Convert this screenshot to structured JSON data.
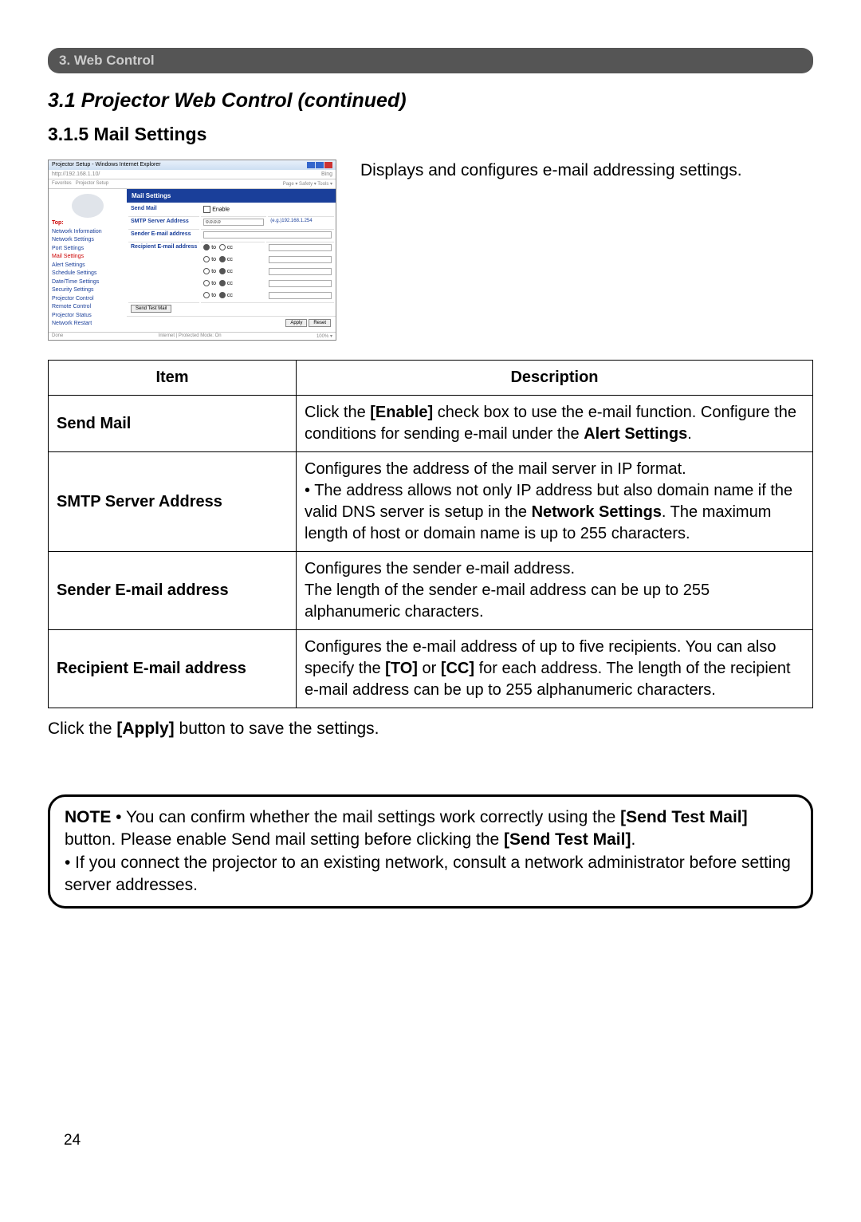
{
  "sectionHeader": "3. Web Control",
  "sectionTitle": "3.1 Projector Web Control (continued)",
  "subsectionTitle": "3.1.5 Mail Settings",
  "introText": "Displays and configures e-mail addressing settings.",
  "mini": {
    "windowTitle": "Projector Setup - Windows Internet Explorer",
    "url": "http://192.168.1.10/",
    "searchHint": "Bing",
    "favLabel": "Favorites",
    "tabLabel": "Projector Setup",
    "toolbarRight": "Page ▾  Safety ▾  Tools ▾",
    "mainHeader": "Mail Settings",
    "sidebarTop": "Top:",
    "sidebar": [
      "Network Information",
      "Network Settings",
      "Port Settings",
      "Mail Settings",
      "Alert Settings",
      "Schedule Settings",
      "Date/Time Settings",
      "Security Settings",
      "Projector Control",
      "Remote Control",
      "Projector Status",
      "Network Restart"
    ],
    "sidebarActiveIndex": 3,
    "rows": {
      "sendMail": "Send Mail",
      "enable": "Enable",
      "smtp": "SMTP Server Address",
      "smtpVal": "0.0.0.0",
      "smtpEx": "(e.g.)192.168.1.254",
      "sender": "Sender E-mail address",
      "recipient": "Recipient E-mail address",
      "to": "to",
      "cc": "cc"
    },
    "sendTest": "Send Test Mail",
    "apply": "Apply",
    "reset": "Reset",
    "statusLeft": "Done",
    "statusMid": "Internet | Protected Mode: On",
    "statusRight": "100%  ▾"
  },
  "tableHeaders": {
    "item": "Item",
    "desc": "Description"
  },
  "tableRows": [
    {
      "item": "Send Mail",
      "desc_pre": "Click the ",
      "b1": "[Enable]",
      "desc_mid": " check box to use the e-mail function. Configure the conditions for sending e-mail under the ",
      "b2": "Alert Settings",
      "desc_post": "."
    },
    {
      "item": "SMTP Server Address",
      "desc_pre": "Configures the address of the mail server in IP format.\n• The address allows not only IP address but also domain name if the valid DNS server is setup in the ",
      "b1": "Network Settings",
      "desc_post": ". The maximum length of host or domain name is up to 255 characters."
    },
    {
      "item": "Sender E-mail address",
      "desc": "Configures the sender e-mail address.\nThe length of the sender e-mail address can be up to 255 alphanumeric characters."
    },
    {
      "item": "Recipient E-mail address",
      "desc_pre": "Configures the e-mail address of up to five recipients. You can also specify the ",
      "b1": "[TO]",
      "desc_mid": " or ",
      "b2": "[CC]",
      "desc_post": " for each address. The length of the recipient e-mail address can be up to 255 alphanumeric characters."
    }
  ],
  "afterTable_pre": "Click the ",
  "afterTable_b": "[Apply]",
  "afterTable_post": " button to save the settings.",
  "note": {
    "label": "NOTE",
    "p1_pre": " • You can confirm whether the mail settings work correctly using the ",
    "b1": "[Send Test Mail]",
    "p1_mid": " button. Please enable Send mail setting before clicking the ",
    "b2": "[Send Test Mail]",
    "p1_post": ".",
    "p2": "• If you connect the projector to an existing network, consult a network administrator before setting server addresses."
  },
  "pageNumber": "24"
}
